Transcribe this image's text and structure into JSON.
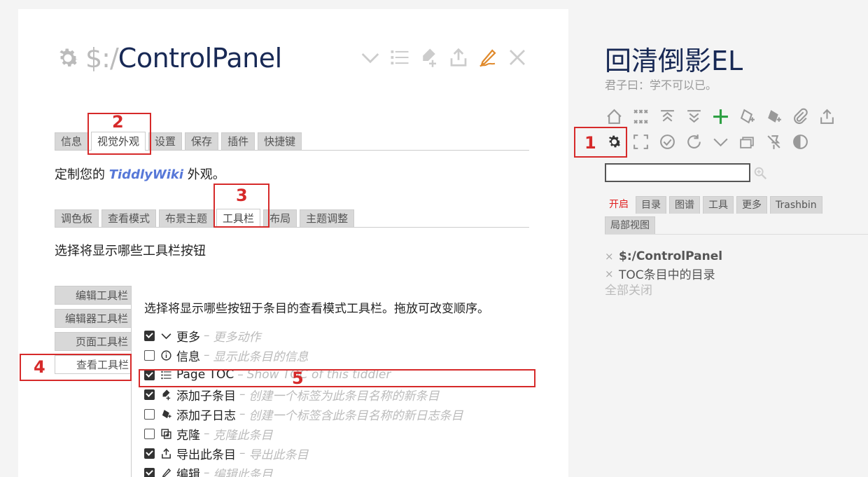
{
  "tiddler": {
    "title_prefix": "$:/",
    "title_name": "ControlPanel",
    "toolbar": [
      "chevron-down-icon",
      "list-icon",
      "new-here-icon",
      "export-icon",
      "edit-icon",
      "close-icon"
    ],
    "main_tabs": [
      "信息",
      "视觉外观",
      "设置",
      "保存",
      "插件",
      "快捷键"
    ],
    "main_tab_active": "视觉外观",
    "desc1_pre": "定制您的 ",
    "desc1_link": "TiddlyWiki",
    "desc1_post": " 外观。",
    "sub_tabs": [
      "调色板",
      "查看模式",
      "布景主题",
      "工具栏",
      "布局",
      "主题调整"
    ],
    "sub_tab_active": "工具栏",
    "desc2": "选择将显示哪些工具栏按钮",
    "vtabs": [
      "编辑工具栏",
      "编辑器工具栏",
      "页面工具栏",
      "查看工具栏"
    ],
    "vtab_active": "查看工具栏",
    "lead": "选择将显示哪些按钮于条目的查看模式工具栏。拖放可改变顺序。",
    "items": [
      {
        "checked": true,
        "icon": "chevron-down-icon",
        "label": "更多",
        "desc": "更多动作"
      },
      {
        "checked": false,
        "icon": "info-icon",
        "label": "信息",
        "desc": "显示此条目的信息"
      },
      {
        "checked": true,
        "icon": "list-icon",
        "label": "Page TOC",
        "desc": "Show TOC of this tiddler"
      },
      {
        "checked": true,
        "icon": "new-here-icon",
        "label": "添加子条目",
        "desc": "创建一个标签为此条目名称的新条目"
      },
      {
        "checked": false,
        "icon": "new-journal-icon",
        "label": "添加子日志",
        "desc": "创建一个标签含此条目名称的新日志条目"
      },
      {
        "checked": false,
        "icon": "clone-icon",
        "label": "克隆",
        "desc": "克隆此条目"
      },
      {
        "checked": true,
        "icon": "export-icon",
        "label": "导出此条目",
        "desc": "导出此条目"
      },
      {
        "checked": true,
        "icon": "edit-icon",
        "label": "编辑",
        "desc": "编辑此条目"
      }
    ],
    "sep": "–"
  },
  "sidebar": {
    "site_title": "回清倒影EL",
    "site_subtitle": "君子曰：学不可以已。",
    "icons_row1": [
      "home-icon",
      "close-all-icon",
      "fold-all-icon",
      "unfold-all-icon",
      "new-tiddler-icon",
      "new-journal-icon",
      "new-image-icon",
      "import-icon",
      "export-icon"
    ],
    "icons_row2": [
      "control-panel-icon",
      "fullscreen-icon",
      "check-icon",
      "refresh-icon",
      "chevron-down-icon",
      "layout-icon",
      "no-tags-icon",
      "theme-icon"
    ],
    "search_placeholder": "",
    "tabs": [
      "开启",
      "目录",
      "图谱",
      "工具",
      "更多",
      "Trashbin",
      "局部视图"
    ],
    "tab_active": "开启",
    "open": [
      {
        "label": "$:/ControlPanel",
        "bold": true
      },
      {
        "label": "TOC条目中的目录",
        "bold": false
      }
    ],
    "close_all": "全部关闭"
  },
  "annotations": [
    "1",
    "2",
    "3",
    "4",
    "5"
  ],
  "colors": {
    "title": "#182955",
    "accent_red": "#d62a2a",
    "link": "#5778d8",
    "icon": "#999999",
    "add": "#2ea043",
    "edit": "#e08a2c"
  }
}
